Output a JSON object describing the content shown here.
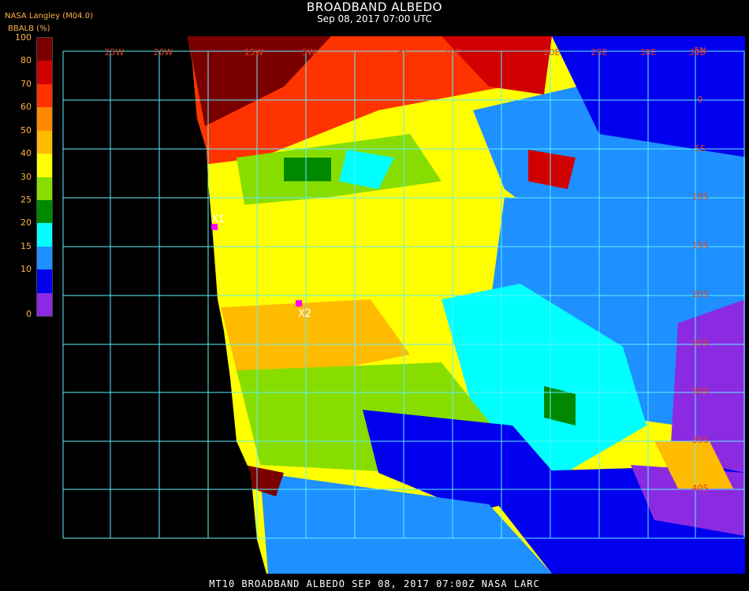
{
  "header": {
    "title": "BROADBAND ALBEDO",
    "subtitle": "Sep 08, 2017 07:00 UTC",
    "source": "NASA Langley (M04.0)",
    "units": "BBALB (%)"
  },
  "legend": {
    "ticks": [
      "100",
      "80",
      "70",
      "60",
      "50",
      "40",
      "30",
      "25",
      "20",
      "15",
      "10",
      "0"
    ],
    "colors": [
      "#7a0000",
      "#d00000",
      "#ff3300",
      "#ff8800",
      "#ffbb00",
      "#ffff00",
      "#88dd00",
      "#008800",
      "#00ffff",
      "#1e90ff",
      "#0000ee",
      "#8a2be2"
    ]
  },
  "map": {
    "lon_labels": [
      "25W",
      "20W",
      "15W",
      "5W",
      "5E",
      "10E",
      "20E",
      "25E",
      "30E",
      "35E"
    ],
    "lat_labels": [
      "5N",
      "0",
      "5S",
      "10S",
      "15S",
      "20S",
      "25S",
      "30S",
      "35S",
      "40S"
    ],
    "markers": [
      {
        "label": "X1",
        "color": "#ff00ff"
      },
      {
        "label": "X2",
        "color": "#ff00ff"
      }
    ]
  },
  "footer": "MT10  BROADBAND ALBEDO   SEP 08, 2017 07:00Z   NASA LARC"
}
